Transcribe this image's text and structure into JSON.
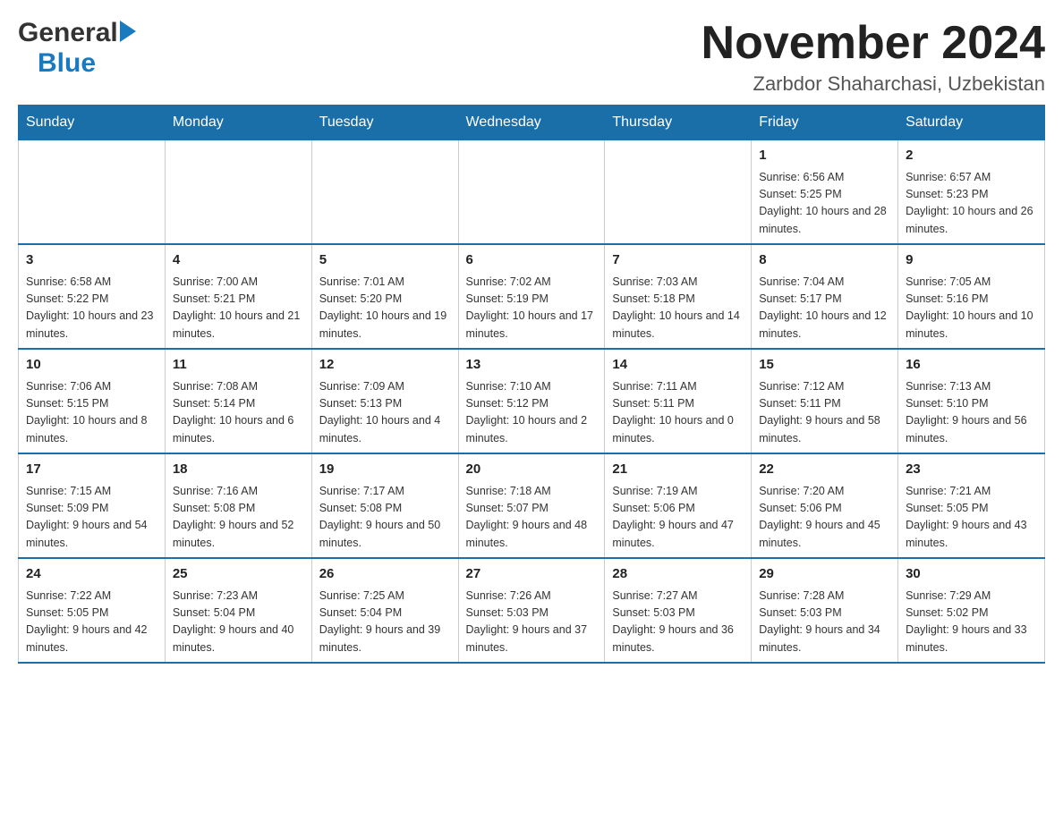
{
  "header": {
    "logo_general": "General",
    "logo_blue": "Blue",
    "month_title": "November 2024",
    "location": "Zarbdor Shaharchasi, Uzbekistan"
  },
  "days_of_week": [
    "Sunday",
    "Monday",
    "Tuesday",
    "Wednesday",
    "Thursday",
    "Friday",
    "Saturday"
  ],
  "weeks": [
    {
      "days": [
        {
          "num": "",
          "info": ""
        },
        {
          "num": "",
          "info": ""
        },
        {
          "num": "",
          "info": ""
        },
        {
          "num": "",
          "info": ""
        },
        {
          "num": "",
          "info": ""
        },
        {
          "num": "1",
          "info": "Sunrise: 6:56 AM\nSunset: 5:25 PM\nDaylight: 10 hours and 28 minutes."
        },
        {
          "num": "2",
          "info": "Sunrise: 6:57 AM\nSunset: 5:23 PM\nDaylight: 10 hours and 26 minutes."
        }
      ]
    },
    {
      "days": [
        {
          "num": "3",
          "info": "Sunrise: 6:58 AM\nSunset: 5:22 PM\nDaylight: 10 hours and 23 minutes."
        },
        {
          "num": "4",
          "info": "Sunrise: 7:00 AM\nSunset: 5:21 PM\nDaylight: 10 hours and 21 minutes."
        },
        {
          "num": "5",
          "info": "Sunrise: 7:01 AM\nSunset: 5:20 PM\nDaylight: 10 hours and 19 minutes."
        },
        {
          "num": "6",
          "info": "Sunrise: 7:02 AM\nSunset: 5:19 PM\nDaylight: 10 hours and 17 minutes."
        },
        {
          "num": "7",
          "info": "Sunrise: 7:03 AM\nSunset: 5:18 PM\nDaylight: 10 hours and 14 minutes."
        },
        {
          "num": "8",
          "info": "Sunrise: 7:04 AM\nSunset: 5:17 PM\nDaylight: 10 hours and 12 minutes."
        },
        {
          "num": "9",
          "info": "Sunrise: 7:05 AM\nSunset: 5:16 PM\nDaylight: 10 hours and 10 minutes."
        }
      ]
    },
    {
      "days": [
        {
          "num": "10",
          "info": "Sunrise: 7:06 AM\nSunset: 5:15 PM\nDaylight: 10 hours and 8 minutes."
        },
        {
          "num": "11",
          "info": "Sunrise: 7:08 AM\nSunset: 5:14 PM\nDaylight: 10 hours and 6 minutes."
        },
        {
          "num": "12",
          "info": "Sunrise: 7:09 AM\nSunset: 5:13 PM\nDaylight: 10 hours and 4 minutes."
        },
        {
          "num": "13",
          "info": "Sunrise: 7:10 AM\nSunset: 5:12 PM\nDaylight: 10 hours and 2 minutes."
        },
        {
          "num": "14",
          "info": "Sunrise: 7:11 AM\nSunset: 5:11 PM\nDaylight: 10 hours and 0 minutes."
        },
        {
          "num": "15",
          "info": "Sunrise: 7:12 AM\nSunset: 5:11 PM\nDaylight: 9 hours and 58 minutes."
        },
        {
          "num": "16",
          "info": "Sunrise: 7:13 AM\nSunset: 5:10 PM\nDaylight: 9 hours and 56 minutes."
        }
      ]
    },
    {
      "days": [
        {
          "num": "17",
          "info": "Sunrise: 7:15 AM\nSunset: 5:09 PM\nDaylight: 9 hours and 54 minutes."
        },
        {
          "num": "18",
          "info": "Sunrise: 7:16 AM\nSunset: 5:08 PM\nDaylight: 9 hours and 52 minutes."
        },
        {
          "num": "19",
          "info": "Sunrise: 7:17 AM\nSunset: 5:08 PM\nDaylight: 9 hours and 50 minutes."
        },
        {
          "num": "20",
          "info": "Sunrise: 7:18 AM\nSunset: 5:07 PM\nDaylight: 9 hours and 48 minutes."
        },
        {
          "num": "21",
          "info": "Sunrise: 7:19 AM\nSunset: 5:06 PM\nDaylight: 9 hours and 47 minutes."
        },
        {
          "num": "22",
          "info": "Sunrise: 7:20 AM\nSunset: 5:06 PM\nDaylight: 9 hours and 45 minutes."
        },
        {
          "num": "23",
          "info": "Sunrise: 7:21 AM\nSunset: 5:05 PM\nDaylight: 9 hours and 43 minutes."
        }
      ]
    },
    {
      "days": [
        {
          "num": "24",
          "info": "Sunrise: 7:22 AM\nSunset: 5:05 PM\nDaylight: 9 hours and 42 minutes."
        },
        {
          "num": "25",
          "info": "Sunrise: 7:23 AM\nSunset: 5:04 PM\nDaylight: 9 hours and 40 minutes."
        },
        {
          "num": "26",
          "info": "Sunrise: 7:25 AM\nSunset: 5:04 PM\nDaylight: 9 hours and 39 minutes."
        },
        {
          "num": "27",
          "info": "Sunrise: 7:26 AM\nSunset: 5:03 PM\nDaylight: 9 hours and 37 minutes."
        },
        {
          "num": "28",
          "info": "Sunrise: 7:27 AM\nSunset: 5:03 PM\nDaylight: 9 hours and 36 minutes."
        },
        {
          "num": "29",
          "info": "Sunrise: 7:28 AM\nSunset: 5:03 PM\nDaylight: 9 hours and 34 minutes."
        },
        {
          "num": "30",
          "info": "Sunrise: 7:29 AM\nSunset: 5:02 PM\nDaylight: 9 hours and 33 minutes."
        }
      ]
    }
  ]
}
